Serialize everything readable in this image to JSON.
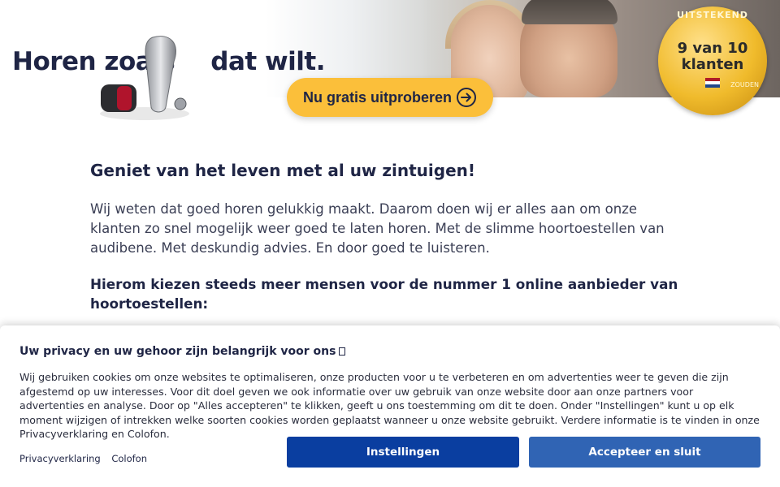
{
  "hero": {
    "title_part1": "Horen zoals",
    "title_part2": "dat wilt.",
    "cta_label": "Nu gratis uitproberen",
    "cta_icon": "arrow-right-circle-icon",
    "seal": {
      "top_text": "UITSTEKEND",
      "line1": "9 van 10",
      "line2": "klanten",
      "bottom_text": "ZOUDEN",
      "flag_colors": [
        "#ae1c28",
        "#ffffff",
        "#21468b"
      ]
    }
  },
  "main": {
    "heading": "Geniet van het leven met al uw zintuigen!",
    "body": "Wij weten dat goed horen gelukkig maakt. Daarom doen wij er alles aan om onze klanten zo snel mogelijk weer goed te laten horen. Met de slimme hoortoestellen van audibene. Met deskundig advies. En door goed te luisteren.",
    "subheading": "Hierom kiezen steeds meer mensen voor de nummer 1 online aanbieder van hoortoestellen:"
  },
  "cookie_banner": {
    "title": "Uw privacy en uw gehoor zijn belangrijk voor ons",
    "text": "Wij gebruiken cookies om onze websites te optimaliseren, onze producten voor u te verbeteren en om advertenties weer te geven die zijn afgestemd op uw interesses. Voor dit doel geven we ook informatie over uw gebruik van onze website door aan onze partners voor advertenties en analyse. Door op \"Alles accepteren\" te klikken, geeft u ons toestemming om dit te doen. Onder \"Instellingen\" kunt u op elk moment wijzigen of intrekken welke soorten cookies worden geplaatst wanneer u onze website gebruikt. Verdere informatie is te vinden in onze Privacyverklaring en Colofon.",
    "links": [
      "Privacyverklaring",
      "Colofon"
    ],
    "settings_label": "Instellingen",
    "accept_label": "Accepteer en sluit"
  },
  "colors": {
    "navy": "#1f2545",
    "cta_yellow": "#fbbf3a",
    "settings_blue": "#0a3ea0",
    "accept_blue": "#3064b4"
  }
}
